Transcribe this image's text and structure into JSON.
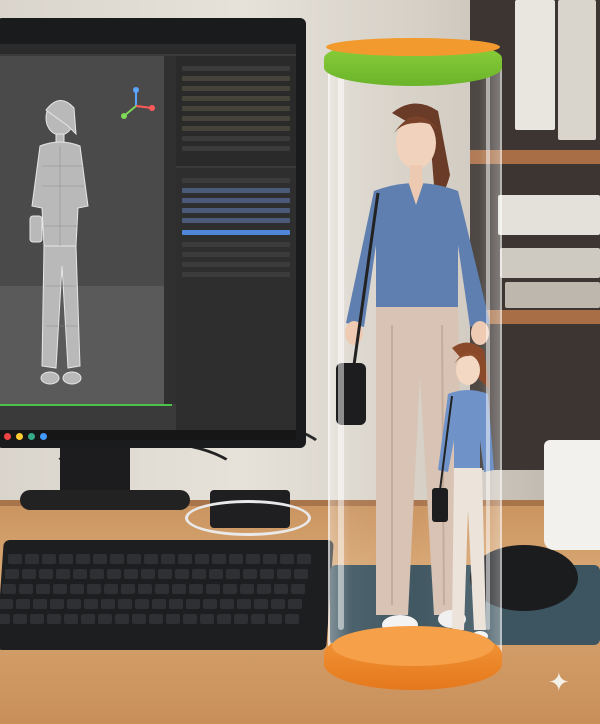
{
  "scene": {
    "description_tags": [
      "monitor",
      "3d-modeling-app",
      "figure-tube",
      "keyboard",
      "mouse",
      "mug",
      "bookshelf"
    ]
  },
  "colors": {
    "tube_cap": "#7cc234",
    "tube_base": "#ee8a2e",
    "shirt": "#5f7fb0",
    "pants": "#d8c3b4",
    "desk": "#d4a06b"
  },
  "icons": {
    "sparkle": "sparkle-icon"
  }
}
